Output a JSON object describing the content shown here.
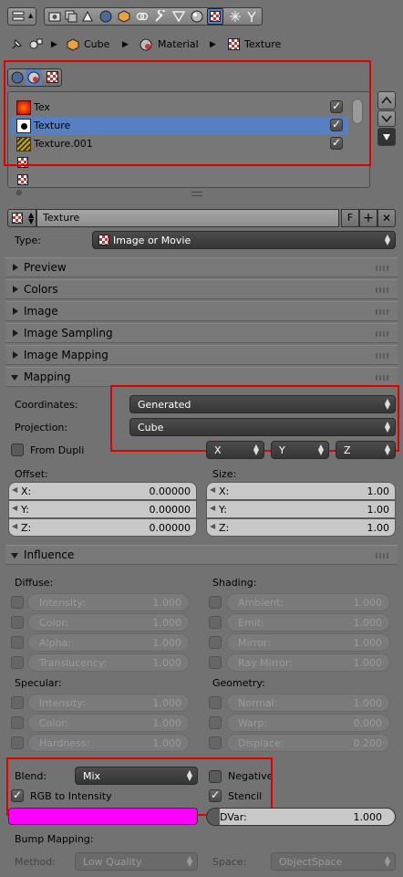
{
  "colors": {
    "selection": "#5680c2",
    "stencil_color": "#ff00ff",
    "highlight_box": "#e00000"
  },
  "context": {
    "cube": "Cube",
    "material": "Material",
    "texture": "Texture"
  },
  "texture_slots": [
    {
      "name": "Tex",
      "checked": true,
      "icon": "tex-image-icon"
    },
    {
      "name": "Texture",
      "checked": true,
      "selected": true,
      "icon": "texture-dot-icon"
    },
    {
      "name": "Texture.001",
      "checked": true,
      "icon": "texture-stripes-icon"
    },
    {
      "name": ""
    },
    {
      "name": ""
    }
  ],
  "datablock": {
    "name": "Texture",
    "fake_user": "F"
  },
  "type": {
    "label": "Type:",
    "value": "Image or Movie"
  },
  "panels": [
    "Preview",
    "Colors",
    "Image",
    "Image Sampling",
    "Image Mapping"
  ],
  "mapping": {
    "title": "Mapping",
    "coordinates_label": "Coordinates:",
    "coordinates": "Generated",
    "projection_label": "Projection:",
    "projection": "Cube",
    "from_dupli": "From Dupli",
    "axes": [
      "X",
      "Y",
      "Z"
    ],
    "offset_label": "Offset:",
    "size_label": "Size:",
    "offset": [
      {
        "k": "X:",
        "v": "0.00000"
      },
      {
        "k": "Y:",
        "v": "0.00000"
      },
      {
        "k": "Z:",
        "v": "0.00000"
      }
    ],
    "size": [
      {
        "k": "X:",
        "v": "1.00"
      },
      {
        "k": "Y:",
        "v": "1.00"
      },
      {
        "k": "Z:",
        "v": "1.00"
      }
    ]
  },
  "influence": {
    "title": "Influence",
    "diffuse_label": "Diffuse:",
    "diffuse": [
      {
        "k": "Intensity:",
        "v": "1.000"
      },
      {
        "k": "Color:",
        "v": "1.000"
      },
      {
        "k": "Alpha:",
        "v": "1.000"
      },
      {
        "k": "Translucency:",
        "v": "1.000"
      }
    ],
    "shading_label": "Shading:",
    "shading": [
      {
        "k": "Ambient:",
        "v": "1.000"
      },
      {
        "k": "Emit:",
        "v": "1.000"
      },
      {
        "k": "Mirror:",
        "v": "1.000"
      },
      {
        "k": "Ray Mirror:",
        "v": "1.000"
      }
    ],
    "specular_label": "Specular:",
    "specular": [
      {
        "k": "Intensity:",
        "v": "1.000"
      },
      {
        "k": "Color:",
        "v": "1.000"
      },
      {
        "k": "Hardness:",
        "v": "1.000"
      }
    ],
    "geometry_label": "Geometry:",
    "geometry": [
      {
        "k": "Normal:",
        "v": "1.000"
      },
      {
        "k": "Warp:",
        "v": "0.000"
      },
      {
        "k": "Displace:",
        "v": "0.200"
      }
    ],
    "blend_label": "Blend:",
    "blend": "Mix",
    "negative": "Negative",
    "rgb_to_intensity": "RGB to Intensity",
    "stencil": "Stencil",
    "dvar_label": "DVar:",
    "dvar": "1.000",
    "bump_label": "Bump Mapping:",
    "method_label": "Method:",
    "method": "Low Quality",
    "space_label": "Space:",
    "space": "ObjectSpace"
  }
}
